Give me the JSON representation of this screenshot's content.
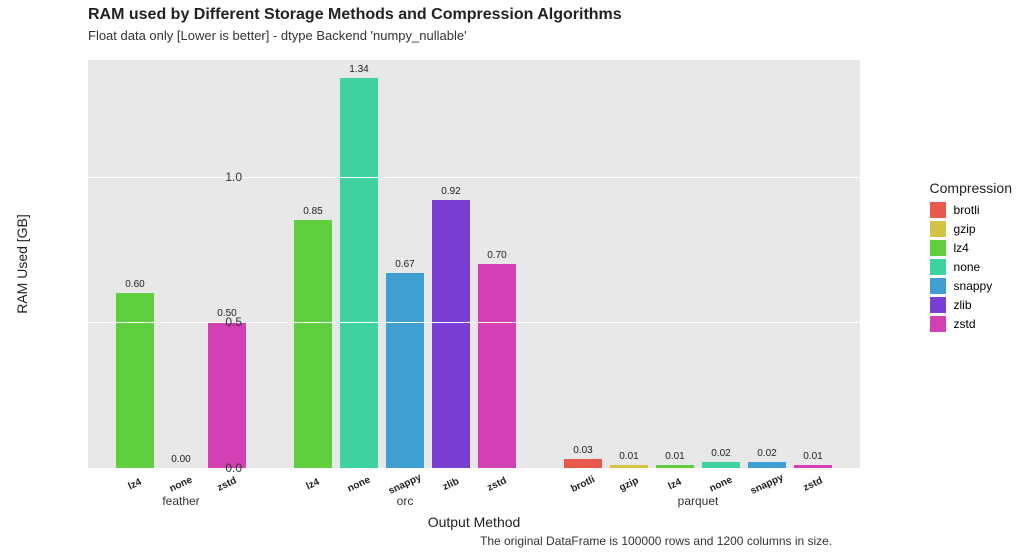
{
  "chart_data": {
    "type": "bar",
    "title": "RAM used by Different Storage Methods and Compression Algorithms",
    "subtitle": "Float data only [Lower is better] - dtype Backend 'numpy_nullable'",
    "ylabel": "RAM Used [GB]",
    "xlabel": "Output Method",
    "caption": "The original DataFrame is 100000 rows and 1200 columns in size.",
    "ylim": [
      0,
      1.4
    ],
    "yticks": [
      0.0,
      0.5,
      1.0
    ],
    "legend_title": "Compression",
    "compression_colors": {
      "brotli": "#e8584c",
      "gzip": "#d3c447",
      "lz4": "#5fcf3f",
      "none": "#3fd2a1",
      "snappy": "#3e9fd0",
      "zlib": "#7a3fd2",
      "zstd": "#d240b3"
    },
    "groups": [
      {
        "name": "feather",
        "bars": [
          {
            "compression": "lz4",
            "value": 0.6
          },
          {
            "compression": "none",
            "value": 0.0
          },
          {
            "compression": "zstd",
            "value": 0.5
          }
        ]
      },
      {
        "name": "orc",
        "bars": [
          {
            "compression": "lz4",
            "value": 0.85
          },
          {
            "compression": "none",
            "value": 1.34
          },
          {
            "compression": "snappy",
            "value": 0.67
          },
          {
            "compression": "zlib",
            "value": 0.92
          },
          {
            "compression": "zstd",
            "value": 0.7
          }
        ]
      },
      {
        "name": "parquet",
        "bars": [
          {
            "compression": "brotli",
            "value": 0.03
          },
          {
            "compression": "gzip",
            "value": 0.01
          },
          {
            "compression": "lz4",
            "value": 0.01
          },
          {
            "compression": "none",
            "value": 0.02
          },
          {
            "compression": "snappy",
            "value": 0.02
          },
          {
            "compression": "zstd",
            "value": 0.01
          }
        ]
      }
    ]
  }
}
